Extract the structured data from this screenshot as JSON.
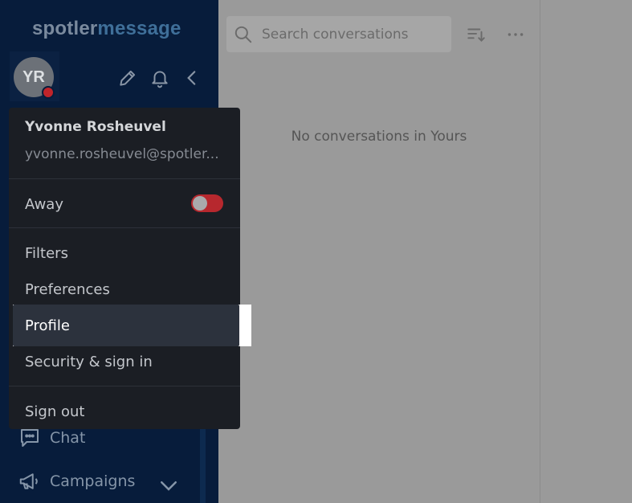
{
  "brand": {
    "name_part1": "spotler",
    "name_part2": "message"
  },
  "user": {
    "initials": "YR",
    "name": "Yvonne Rosheuvel",
    "email": "yvonne.rosheuvel@spotler..."
  },
  "sidebar": {
    "nav_items": [
      {
        "label": "Chat",
        "icon": "chat-icon"
      },
      {
        "label": "Campaigns",
        "icon": "megaphone-icon"
      }
    ]
  },
  "search": {
    "placeholder": "Search conversations"
  },
  "conversations": {
    "empty_message": "No conversations in Yours"
  },
  "menu": {
    "away_label": "Away",
    "items": [
      {
        "label": "Filters"
      },
      {
        "label": "Preferences"
      },
      {
        "label": "Profile"
      },
      {
        "label": "Security & sign in"
      }
    ],
    "sign_out_label": "Sign out"
  },
  "colors": {
    "sidebar_bg": "#071c3b",
    "menu_bg": "#1b1e24",
    "status_away": "#c0242a"
  },
  "icons": [
    "search-icon",
    "pencil-icon",
    "bell-icon",
    "chevron-left-icon",
    "sort-icon",
    "more-icon",
    "chevron-down-icon"
  ]
}
